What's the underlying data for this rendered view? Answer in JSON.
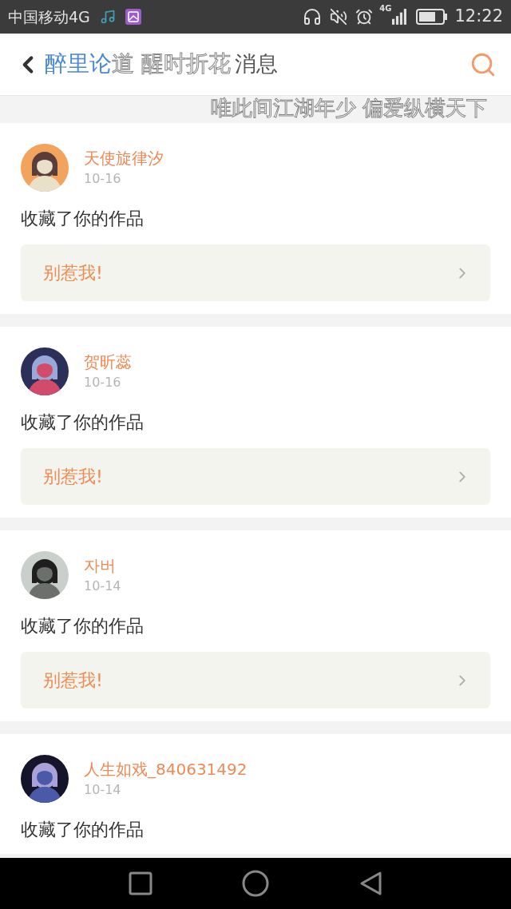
{
  "status_bar": {
    "carrier": "中国移动4G",
    "network_label": "4G",
    "time": "12:22"
  },
  "header": {
    "title": "消息"
  },
  "lyrics": {
    "line_1_sung": "醉里论",
    "line_1_rest": "道 醒时折花",
    "line_2": "唯此间江湖年少 偏爱纵横天下"
  },
  "notifications": [
    {
      "user": "天使旋律汐",
      "date": "10-16",
      "action": "收藏了你的作品",
      "work": "别惹我!"
    },
    {
      "user": "贺昕蕊",
      "date": "10-16",
      "action": "收藏了你的作品",
      "work": "别惹我!"
    },
    {
      "user": "자버",
      "date": "10-14",
      "action": "收藏了你的作品",
      "work": "别惹我!"
    },
    {
      "user": "人生如戏_840631492",
      "date": "10-14",
      "action": "收藏了你的作品"
    }
  ]
}
